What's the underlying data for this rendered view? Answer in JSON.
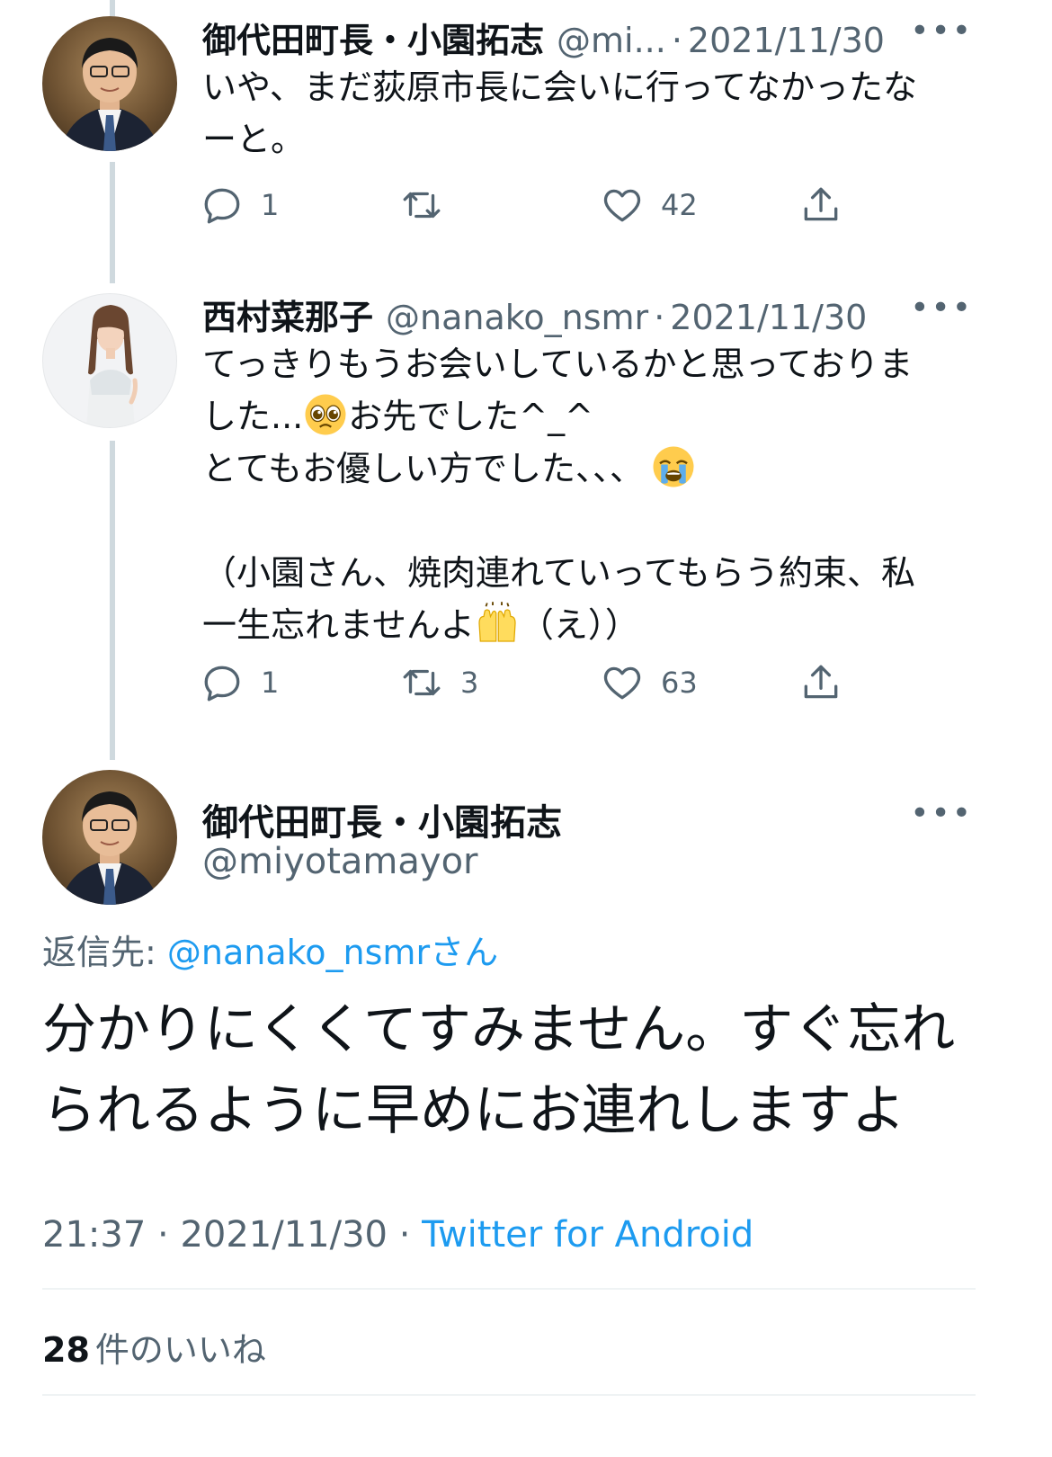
{
  "tweets": [
    {
      "name": "御代田町長・小園拓志",
      "handle": "@mi...",
      "sep": "·",
      "date": "2021/11/30",
      "more": "•••",
      "text": "いや、まだ荻原市長に会いに行ってなかったな\nーと。",
      "replies": "1",
      "retweets": "",
      "likes": "42"
    },
    {
      "name": "西村菜那子",
      "handle": "@nanako_nsmr",
      "sep": "·",
      "date": "2021/11/30",
      "more": "•••",
      "text_line1": "てっきりもうお会いしているかと思っておりま",
      "text_line2_a": "した...",
      "text_line2_b": "お先でした^_^",
      "text_line3": "とてもお優しい方でした、、、",
      "text_line4": "（小園さん、焼肉連れていってもらう約束、私",
      "text_line5_a": "一生忘れませんよ",
      "text_line5_b": "（え））",
      "emoji1": "pleading-face-emoji",
      "emoji2": "crying-face-emoji",
      "emoji3": "raising-hands-emoji",
      "replies": "1",
      "retweets": "3",
      "likes": "63"
    }
  ],
  "focus": {
    "name": "御代田町長・小園拓志",
    "handle": "@miyotamayor",
    "more": "•••",
    "reply_label": "返信先:",
    "reply_mention": "@nanako_nsmr",
    "reply_suffix": "さん",
    "text": "分かりにくくてすみません。すぐ忘れ\nられるように早めにお連れしますよ",
    "time": "21:37",
    "sep": "·",
    "date": "2021/11/30",
    "client": "Twitter for Android",
    "like_count": "28",
    "like_label": "件のいいね"
  },
  "colors": {
    "accent": "#1d9bf0",
    "secondary_text": "#536471",
    "thread_line": "#cfd9de"
  },
  "icons": [
    "reply-icon",
    "retweet-icon",
    "like-icon",
    "share-icon",
    "more-icon"
  ]
}
